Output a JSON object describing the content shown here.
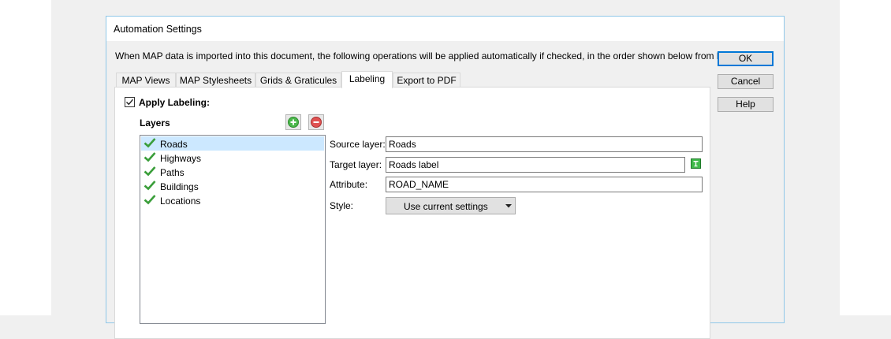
{
  "dialog": {
    "title": "Automation Settings",
    "description": "When MAP data is imported into this document, the following operations will be applied automatically if checked, in the order shown below from left to right."
  },
  "buttons": {
    "ok": "OK",
    "cancel": "Cancel",
    "help": "Help"
  },
  "tabs": [
    {
      "label": "MAP Views",
      "active": false
    },
    {
      "label": "MAP Stylesheets",
      "active": false
    },
    {
      "label": "Grids & Graticules",
      "active": false
    },
    {
      "label": "Labeling",
      "active": true
    },
    {
      "label": "Export to PDF",
      "active": false
    }
  ],
  "labeling": {
    "apply_label": "Apply Labeling:",
    "apply_checked": true,
    "layers_label": "Layers",
    "layers": [
      {
        "name": "Roads",
        "checked": true,
        "selected": true
      },
      {
        "name": "Highways",
        "checked": true,
        "selected": false
      },
      {
        "name": "Paths",
        "checked": true,
        "selected": false
      },
      {
        "name": "Buildings",
        "checked": true,
        "selected": false
      },
      {
        "name": "Locations",
        "checked": true,
        "selected": false
      }
    ],
    "source_layer_label": "Source layer:",
    "source_layer_value": "Roads",
    "target_layer_label": "Target layer:",
    "target_layer_value": "Roads label",
    "attribute_label": "Attribute:",
    "attribute_value": "ROAD_NAME",
    "style_label": "Style:",
    "style_value": "Use current settings"
  },
  "colors": {
    "accent": "#0078d7",
    "selection": "#cce8ff",
    "check_green": "#3a9e3a"
  },
  "icons": {
    "add": "add-layer-icon",
    "remove": "remove-layer-icon",
    "target_text": "text-label-icon",
    "combo_arrow": "dropdown-arrow-icon"
  }
}
